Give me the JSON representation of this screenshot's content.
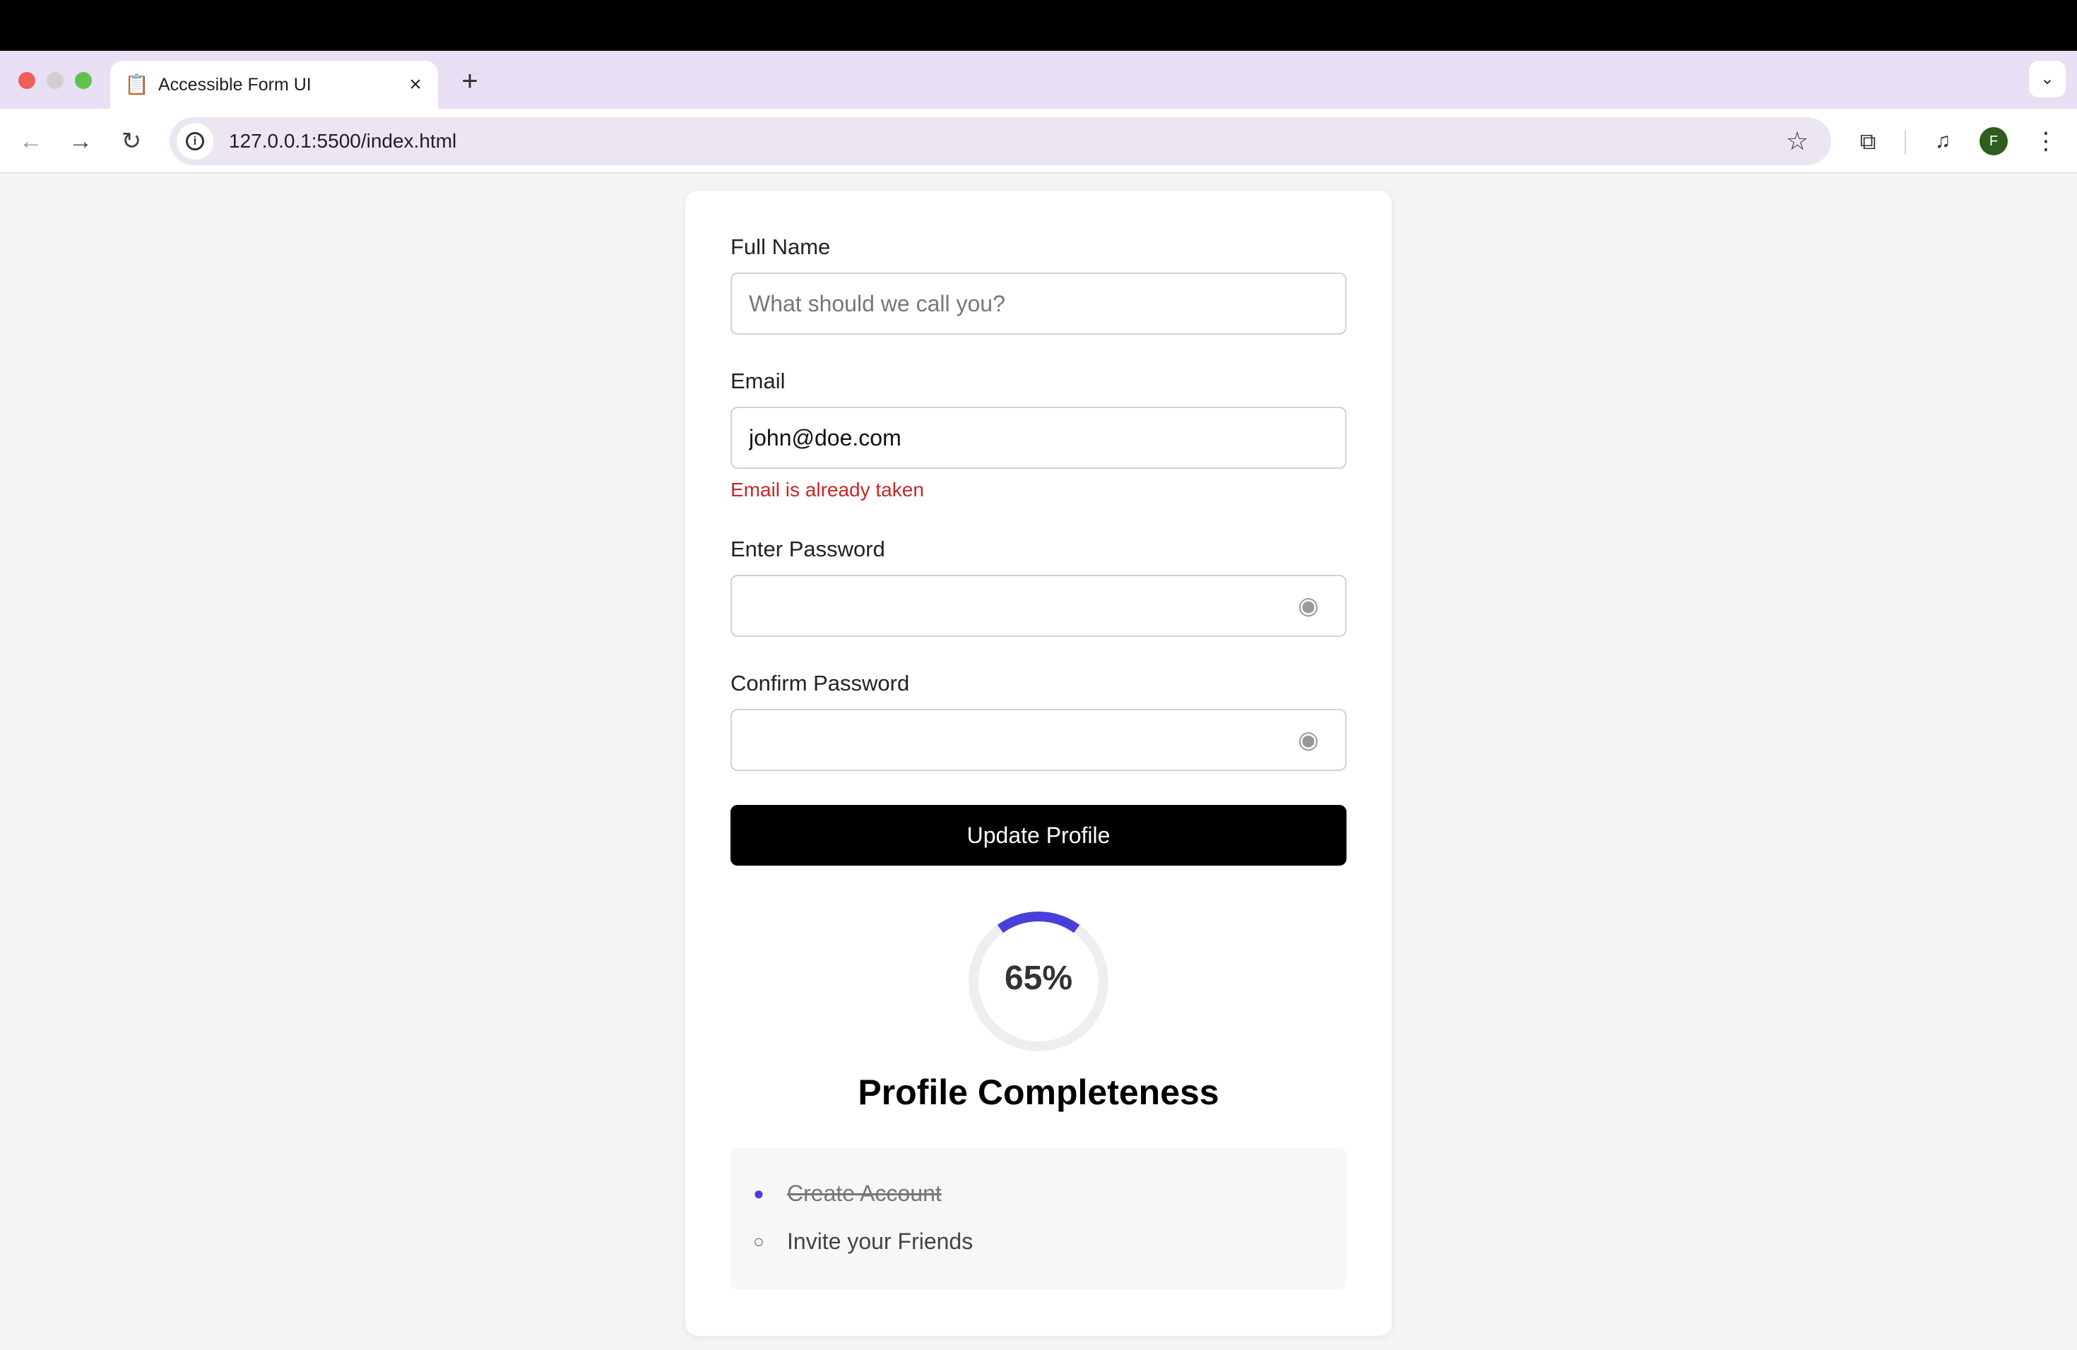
{
  "browser": {
    "tab_title": "Accessible Form UI",
    "url": "127.0.0.1:5500/index.html",
    "profile_initial": "F"
  },
  "form": {
    "full_name": {
      "label": "Full Name",
      "placeholder": "What should we call you?",
      "value": ""
    },
    "email": {
      "label": "Email",
      "value": "john@doe.com",
      "error": "Email is already taken"
    },
    "password": {
      "label": "Enter Password",
      "value": ""
    },
    "confirm_password": {
      "label": "Confirm Password",
      "value": ""
    },
    "submit_label": "Update Profile"
  },
  "progress": {
    "percent_label": "65%",
    "value": 0.65,
    "title": "Profile Completeness",
    "ring_color": "#4a3fdb",
    "track_color": "#eeeeee"
  },
  "checklist": [
    {
      "text": "Create Account",
      "done": true
    },
    {
      "text": "Invite your Friends",
      "done": false
    }
  ],
  "colors": {
    "error": "#c62828",
    "button": "#000000",
    "tabstrip": "#e8dff4"
  }
}
